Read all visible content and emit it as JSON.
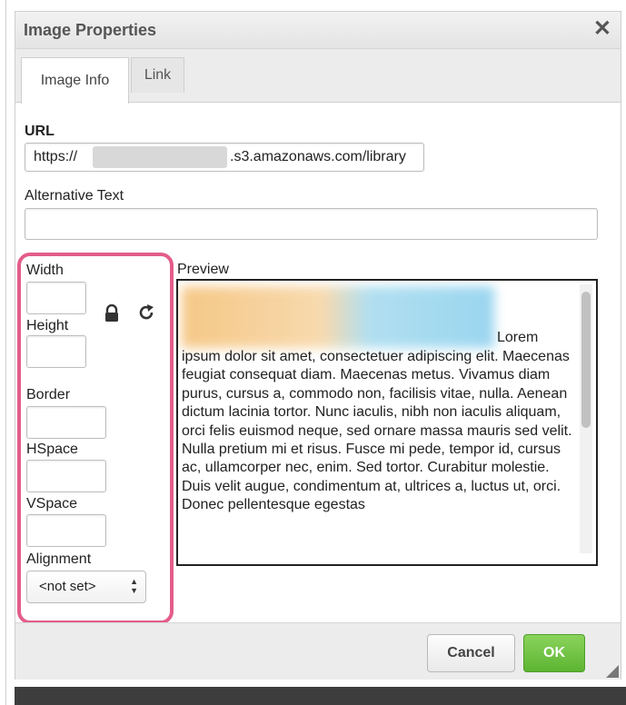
{
  "dialog": {
    "title": "Image Properties",
    "close_glyph": "✕",
    "tabs": [
      {
        "label": "Image Info",
        "active": true
      },
      {
        "label": "Link",
        "active": false
      }
    ]
  },
  "url": {
    "label": "URL",
    "value_prefix": "https://",
    "value_suffix": ".s3.amazonaws.com/library"
  },
  "alt_text": {
    "label": "Alternative Text",
    "value": ""
  },
  "dimensions": {
    "width_label": "Width",
    "height_label": "Height",
    "border_label": "Border",
    "hspace_label": "HSpace",
    "vspace_label": "VSpace",
    "alignment_label": "Alignment",
    "alignment_value": "<not set>",
    "lock_icon": "lock-icon",
    "reset_icon": "reset-size-icon"
  },
  "preview": {
    "label": "Preview",
    "lorem_word": "Lorem",
    "text": "ipsum dolor sit amet, consectetuer adipiscing elit. Maecenas feugiat consequat diam. Maecenas metus. Vivamus diam purus, cursus a, commodo non, facilisis vitae, nulla. Aenean dictum lacinia tortor. Nunc iaculis, nibh non iaculis aliquam, orci felis euismod neque, sed ornare massa mauris sed velit. Nulla pretium mi et risus. Fusce mi pede, tempor id, cursus ac, ullamcorper nec, enim. Sed tortor. Curabitur molestie. Duis velit augue, condimentum at, ultrices a, luctus ut, orci. Donec pellentesque egestas"
  },
  "footer": {
    "cancel_label": "Cancel",
    "ok_label": "OK"
  },
  "colors": {
    "highlight": "#e35d8a",
    "ok_green": "#5cb532"
  }
}
